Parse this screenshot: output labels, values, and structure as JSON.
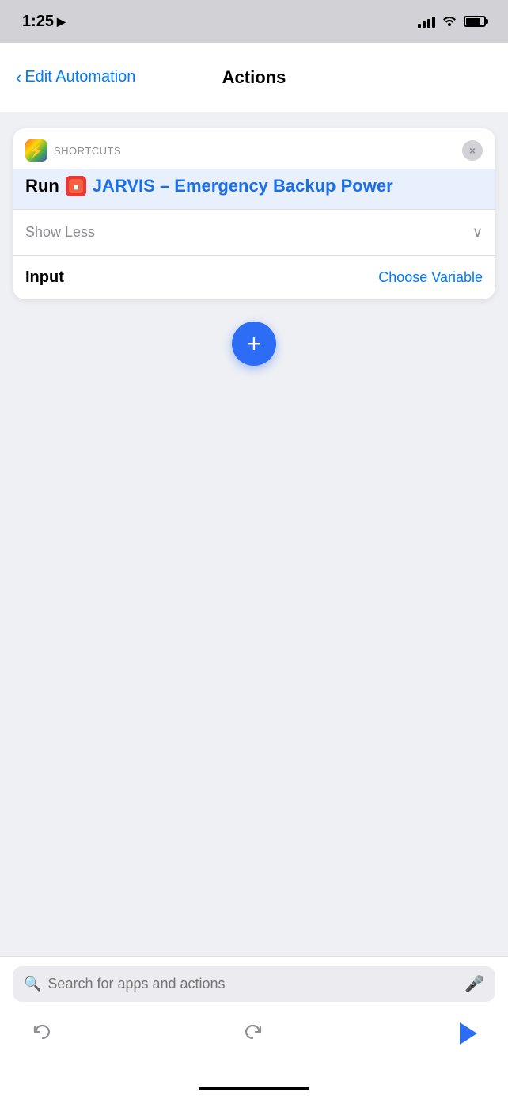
{
  "status_bar": {
    "time": "1:25",
    "location_arrow": "▲"
  },
  "nav": {
    "back_label": "Edit Automation",
    "title": "Actions"
  },
  "card": {
    "shortcuts_label": "SHORTCUTS",
    "run_label": "Run",
    "shortcut_name": "JARVIS – Emergency Backup Power",
    "close_label": "×",
    "show_less_label": "Show Less",
    "input_label": "Input",
    "choose_variable_label": "Choose Variable"
  },
  "add_button": {
    "label": "+"
  },
  "bottom_bar": {
    "search_placeholder": "Search for apps and actions"
  }
}
